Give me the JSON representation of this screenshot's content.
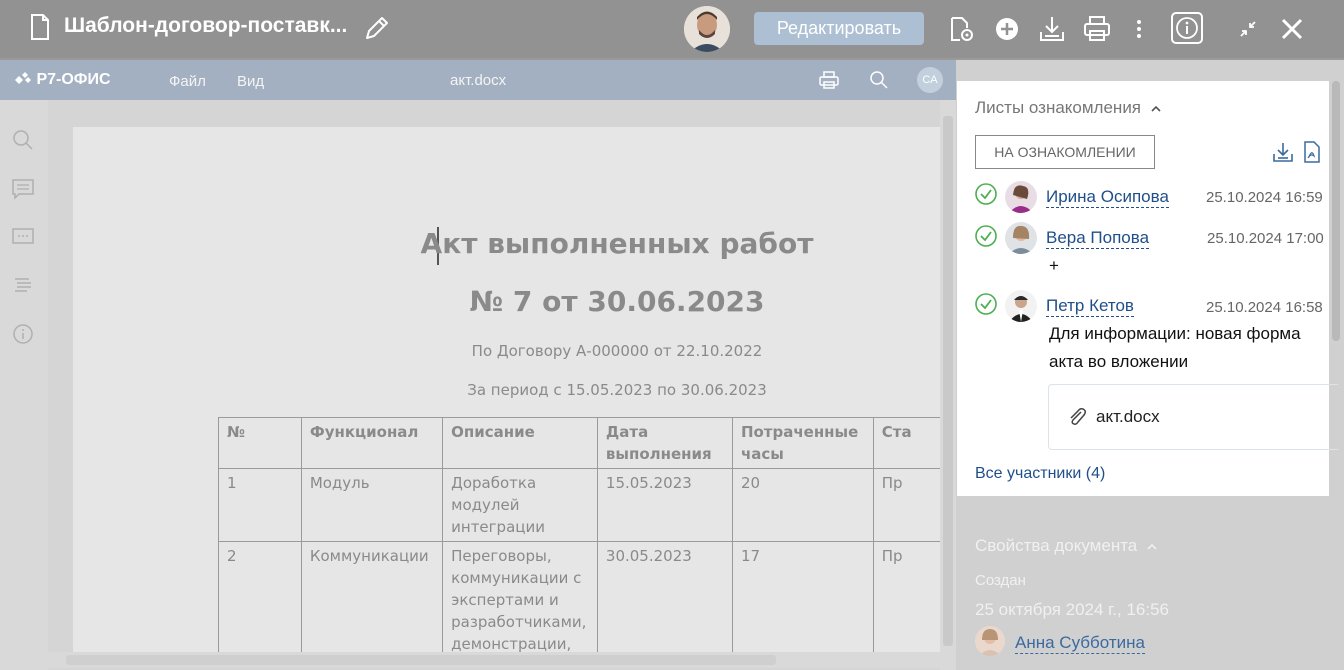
{
  "header": {
    "title": "Шаблон-договор-поставк...",
    "edit_button": "Редактировать",
    "icons": [
      "document-icon",
      "pencil-icon",
      "user-avatar",
      "file-settings-icon",
      "plus-circle-icon",
      "download-icon",
      "print-icon",
      "more-vertical-icon",
      "info-icon",
      "minimize-icon",
      "close-icon"
    ]
  },
  "editor": {
    "app_name": "Р7-ОФИС",
    "menu": [
      "Файл",
      "Вид"
    ],
    "file_name": "акт.docx",
    "user_initials": "CA",
    "document": {
      "title": "Акт выполненных работ",
      "number_line": "№ 7 от 30.06.2023",
      "contract_line": "По Договору А-000000 от 22.10.2022",
      "period_line": "За период с 15.05.2023 по 30.06.2023",
      "table": {
        "headers": [
          "№",
          "Функционал",
          "Описание",
          "Дата выполнения",
          "Потраченные часы",
          "Ста"
        ],
        "rows": [
          [
            "1",
            "Модуль",
            "Доработка модулей интеграции",
            "15.05.2023",
            "20",
            "Пр"
          ],
          [
            "2",
            "Коммуникации",
            "Переговоры, коммуникации с экспертами и разработчиками, демонстрации,",
            "30.05.2023",
            "17",
            "Пр"
          ]
        ]
      }
    }
  },
  "panel": {
    "ack_title": "Листы ознакомления",
    "ack_button": "НА ОЗНАКОМЛЕНИИ",
    "entries": [
      {
        "name": "Ирина Осипова",
        "time": "25.10.2024 16:59",
        "comment": ""
      },
      {
        "name": "Вера Попова",
        "time": "25.10.2024 17:00",
        "comment": "+"
      },
      {
        "name": "Петр Кетов",
        "time": "25.10.2024 16:58",
        "comment": "Для информации: новая форма акта во вложении"
      }
    ],
    "attachment": "акт.docx",
    "all_participants": "Все участники (4)",
    "props_title": "Свойства документа",
    "created_label": "Создан",
    "created_date": "25 октября 2024 г., 16:56",
    "author": "Анна Субботина"
  }
}
